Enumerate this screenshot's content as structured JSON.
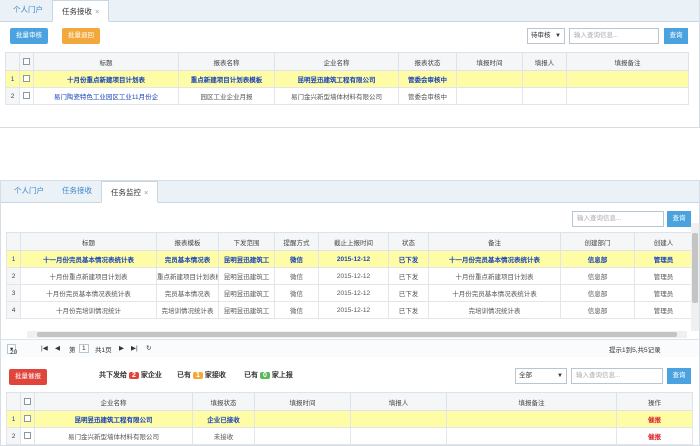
{
  "panel1": {
    "tabs": [
      {
        "label": "个人门户"
      },
      {
        "label": "任务接收",
        "close": "×"
      }
    ],
    "batch_review": "批量审核",
    "batch_return": "批量退回",
    "status_select": "待审核",
    "search_placeholder": "输入查询信息...",
    "query": "查询",
    "columns": [
      "",
      "",
      "标题",
      "报表名称",
      "企业名称",
      "报表状态",
      "填报时间",
      "填报人",
      "填报备注"
    ],
    "rows": [
      {
        "num": "1",
        "title": "十月份重点新建项目计划表",
        "report": "重点新建项目计划表模板",
        "company": "昆明昱迅建筑工程有限公司",
        "status": "管委会审核中",
        "time": "",
        "person": "",
        "note": ""
      },
      {
        "num": "2",
        "title": "易门陶瓷特色工业园区工业11月份企",
        "report": "园区工业企业月报",
        "company": "易门金兴新型墙体材料有限公司",
        "status": "管委会审核中",
        "time": "",
        "person": "",
        "note": ""
      }
    ]
  },
  "panel2": {
    "tabs": [
      {
        "label": "个人门户"
      },
      {
        "label": "任务接收"
      },
      {
        "label": "任务监控",
        "close": "×"
      }
    ],
    "search_placeholder": "输入查询信息...",
    "query": "查询",
    "columns": [
      "",
      "标题",
      "报表模板",
      "下发范围",
      "提醒方式",
      "截止上报时间",
      "状态",
      "备注",
      "创建部门",
      "创建人"
    ],
    "rows": [
      {
        "num": "1",
        "title": "十一月份完员基本情况表统计表",
        "tpl": "完员基本情况表",
        "scope": "昆明昱迅建筑工",
        "remind": "微信",
        "deadline": "2015-12-12",
        "state": "已下发",
        "note": "十一月份完员基本情况表统计表",
        "dept": "信息部",
        "creator": "管理员"
      },
      {
        "num": "2",
        "title": "十月份重点新建项目计划表",
        "tpl": "重点新建项目计划表模",
        "scope": "昆明昱迅建筑工",
        "remind": "微信",
        "deadline": "2015-12-12",
        "state": "已下发",
        "note": "十月份重点新建项目计划表",
        "dept": "信息部",
        "creator": "管理员"
      },
      {
        "num": "3",
        "title": "十月份完员基本情况表统计表",
        "tpl": "完员基本情况表",
        "scope": "昆明昱迅建筑工",
        "remind": "微信",
        "deadline": "2015-12-12",
        "state": "已下发",
        "note": "十月份完员基本情况表统计表",
        "dept": "信息部",
        "creator": "管理员"
      },
      {
        "num": "4",
        "title": "十月份完培训情况统计",
        "tpl": "完培训情况统计表",
        "scope": "昆明昱迅建筑工",
        "remind": "微信",
        "deadline": "2015-12-12",
        "state": "已下发",
        "note": "完培训情况统计表",
        "dept": "信息部",
        "creator": "管理员"
      }
    ],
    "pager": {
      "page_size": "20",
      "page_label": "第",
      "page": "1",
      "total_pages": "共1页",
      "info": "提示1到5,共5记录"
    },
    "batch_remind": "批量催报",
    "stats": {
      "issued_pre": "共下发给",
      "issued_count": "2",
      "issued_post": "家企业",
      "received_pre": "已有",
      "received_count": "1",
      "received_post": "家接收",
      "reported_pre": "已有",
      "reported_count": "0",
      "reported_post": "家上报"
    },
    "filter_select": "全部",
    "search2_placeholder": "输入查询信息...",
    "query2": "查询",
    "sub_columns": [
      "",
      "",
      "企业名称",
      "填报状态",
      "填报时间",
      "填报人",
      "填报备注",
      "操作"
    ],
    "sub_rows": [
      {
        "num": "1",
        "company": "昆明昱迅建筑工程有限公司",
        "status": "企业已接收",
        "time": "",
        "person": "",
        "note": "",
        "action": "催报"
      },
      {
        "num": "2",
        "company": "易门金兴新型墙体材料有限公司",
        "status": "未接收",
        "time": "",
        "person": "",
        "note": "",
        "action": "催报"
      }
    ]
  },
  "colors": {
    "highlight": "#fffca6",
    "accent_blue": "#4aa3df",
    "orange": "#f3a83b",
    "red": "#e0453c",
    "green": "#5cb85c"
  }
}
